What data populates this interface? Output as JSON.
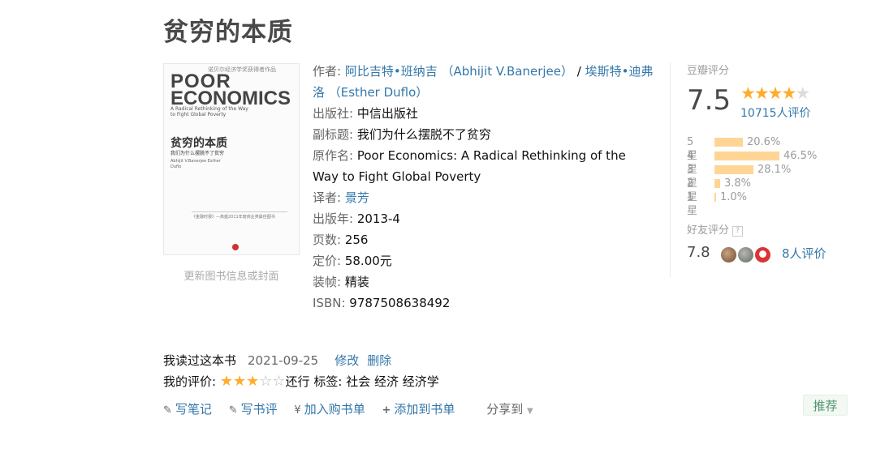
{
  "book": {
    "title": "贫穷的本质",
    "update_cover_text": "更新图书信息或封面",
    "cover": {
      "top_text": "诺贝尔经济学奖获得者作品",
      "title_line1": "POOR",
      "title_line2": "ECONOMICS",
      "subtitle": "A Radical Rethinking of the Way to Fight Global Poverty",
      "cn_title": "贫穷的本质",
      "cn_subtitle": "我们为什么摆脱不了贫穷",
      "authors_text": "Abhijit V.Banerjee Esther Duflo",
      "bottom_text": "《金融时报》—高盛2011年度商业类最佳图书"
    },
    "info": {
      "author_label": "作者:",
      "author1": "阿比吉特•班纳吉 （Abhijit V.Banerjee）",
      "author_sep": " / ",
      "author2": "埃斯特•迪弗洛 （Esther Duflo）",
      "publisher_label": "出版社:",
      "publisher": "中信出版社",
      "subtitle_label": "副标题:",
      "subtitle": "我们为什么摆脱不了贫穷",
      "original_label": "原作名:",
      "original": "Poor Economics: A Radical Rethinking of the Way to Fight Global Poverty",
      "translator_label": "译者:",
      "translator": "景芳",
      "year_label": "出版年:",
      "year": "2013-4",
      "pages_label": "页数:",
      "pages": "256",
      "price_label": "定价:",
      "price": "58.00元",
      "binding_label": "装帧:",
      "binding": "精装",
      "isbn_label": "ISBN:",
      "isbn": "9787508638492"
    }
  },
  "rating": {
    "label": "豆瓣评分",
    "score": "7.5",
    "stars": 4,
    "count": "10715人评价",
    "breakdown": [
      {
        "label": "5星",
        "pct": "20.6%",
        "value": 20.6
      },
      {
        "label": "4星",
        "pct": "46.5%",
        "value": 46.5
      },
      {
        "label": "3星",
        "pct": "28.1%",
        "value": 28.1
      },
      {
        "label": "2星",
        "pct": "3.8%",
        "value": 3.8
      },
      {
        "label": "1星",
        "pct": "1.0%",
        "value": 1.0
      }
    ],
    "bar_color": "#ffd596",
    "star_color": "#ffac2d"
  },
  "friends": {
    "label": "好友评分",
    "help": "?",
    "score": "7.8",
    "count": "8人评价"
  },
  "my": {
    "status": "我读过这本书",
    "date": "2021-09-25",
    "edit": "修改",
    "delete": "删除",
    "rating_label": "我的评价:",
    "my_stars": 3,
    "rating_word": "还行",
    "tags_label": "标签:",
    "tags": "社会 经济 经济学"
  },
  "actions": {
    "write_note": "写笔记",
    "write_review": "写书评",
    "add_cart": "加入购书单",
    "add_list": "添加到书单",
    "share": "分享到"
  },
  "recommend": "推荐"
}
